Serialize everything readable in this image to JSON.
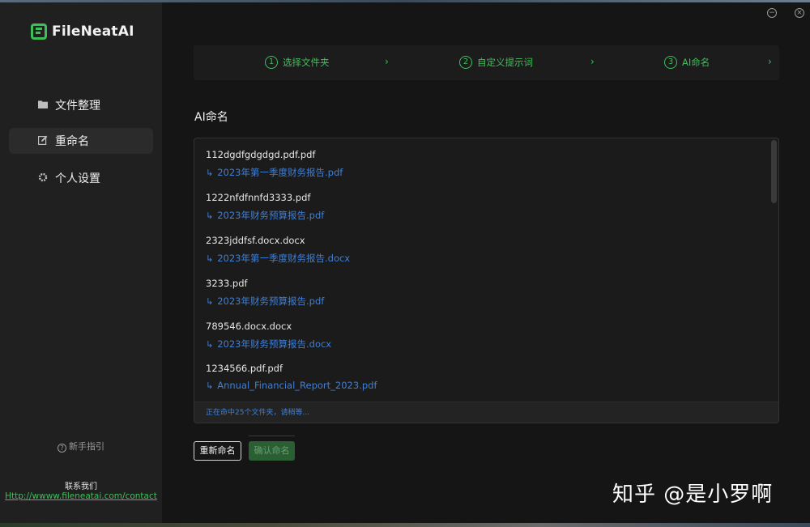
{
  "app": {
    "logo_text": "FileNeatAI",
    "accent": "#3fbf5a",
    "link_color": "#3f7fd6"
  },
  "sidebar": {
    "items": [
      {
        "label": "文件整理",
        "icon": "folder-icon"
      },
      {
        "label": "重命名",
        "icon": "edit-icon",
        "active": true
      },
      {
        "label": "个人设置",
        "icon": "gear-icon"
      }
    ],
    "guide_label": "新手指引",
    "contact_title": "联系我们",
    "contact_link": "Http://wwww.fileneatai.com/contact"
  },
  "window_controls": {
    "minimize": "−",
    "close": "×"
  },
  "steps": [
    {
      "num": "1",
      "label": "选择文件夹"
    },
    {
      "num": "2",
      "label": "自定义提示词"
    },
    {
      "num": "3",
      "label": "AI命名"
    }
  ],
  "section_title": "AI命名",
  "files": [
    {
      "original": "112dgdfgdgdgd.pdf.pdf",
      "renamed": "2023年第一季度财务报告.pdf"
    },
    {
      "original": "1222nfdfnnfd3333.pdf",
      "renamed": "2023年财务预算报告.pdf"
    },
    {
      "original": "2323jddfsf.docx.docx",
      "renamed": "2023年第一季度财务报告.docx"
    },
    {
      "original": "3233.pdf",
      "renamed": "2023年财务预算报告.pdf"
    },
    {
      "original": "789546.docx.docx",
      "renamed": "2023年财务预算报告.docx"
    },
    {
      "original": "1234566.pdf.pdf",
      "renamed": "Annual_Financial_Report_2023.pdf"
    }
  ],
  "status_text": "正在命中25个文件夹，请稍等...",
  "buttons": {
    "rename": "重新命名",
    "confirm": "确认命名"
  },
  "watermark": "知乎 @是小罗啊"
}
